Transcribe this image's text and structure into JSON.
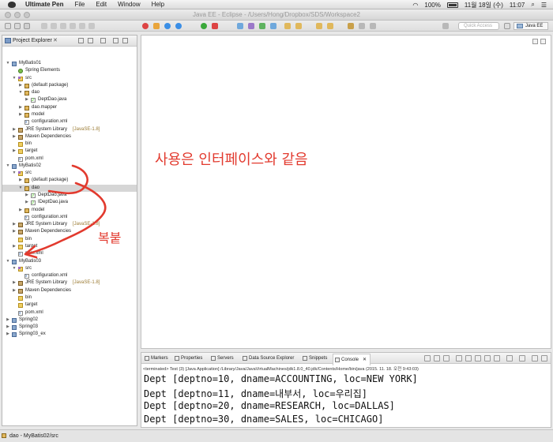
{
  "menubar": {
    "app_name": "Ultimate Pen",
    "items": [
      "File",
      "Edit",
      "Window",
      "Help"
    ],
    "battery": "100%",
    "date": "11월 18일 (수)",
    "time": "11:07"
  },
  "window": {
    "title": "Java EE - Eclipse - /Users/Hong/Dropbox/SDS/Workspace2"
  },
  "toolbar": {
    "quick_access_placeholder": "Quick Access",
    "perspective": "Java EE"
  },
  "explorer": {
    "title": "Project Explorer",
    "tree": [
      {
        "label": "MyBatis01",
        "type": "proj",
        "depth": 0,
        "tw": "▼"
      },
      {
        "label": "Spring Elements",
        "type": "spring",
        "depth": 1,
        "tw": ""
      },
      {
        "label": "src",
        "type": "srcf",
        "depth": 1,
        "tw": "▼"
      },
      {
        "label": "(default package)",
        "type": "pkg",
        "depth": 2,
        "tw": "▶"
      },
      {
        "label": "dao",
        "type": "pkg",
        "depth": 2,
        "tw": "▼"
      },
      {
        "label": "DeptDao.java",
        "type": "java",
        "depth": 3,
        "tw": "▶"
      },
      {
        "label": "dao.mapper",
        "type": "pkg",
        "depth": 2,
        "tw": "▶"
      },
      {
        "label": "model",
        "type": "pkg",
        "depth": 2,
        "tw": "▶"
      },
      {
        "label": "configuration.xml",
        "type": "xml",
        "depth": 2,
        "tw": ""
      },
      {
        "label": "JRE System Library",
        "dec": "[JavaSE-1.8]",
        "type": "lib",
        "depth": 1,
        "tw": "▶"
      },
      {
        "label": "Maven Dependencies",
        "type": "lib",
        "depth": 1,
        "tw": "▶"
      },
      {
        "label": "bin",
        "type": "folder",
        "depth": 1,
        "tw": ""
      },
      {
        "label": "target",
        "type": "folder",
        "depth": 1,
        "tw": "▶"
      },
      {
        "label": "pom.xml",
        "type": "xml",
        "depth": 1,
        "tw": ""
      },
      {
        "label": "MyBatis02",
        "type": "proj",
        "depth": 0,
        "tw": "▼"
      },
      {
        "label": "src",
        "type": "srcf",
        "depth": 1,
        "tw": "▼"
      },
      {
        "label": "(default package)",
        "type": "pkg",
        "depth": 2,
        "tw": "▶"
      },
      {
        "label": "dao",
        "type": "pkg",
        "depth": 2,
        "tw": "▼",
        "selected": true
      },
      {
        "label": "DeptDao.java",
        "type": "java",
        "depth": 3,
        "tw": "▶"
      },
      {
        "label": "IDeptDao.java",
        "type": "java",
        "depth": 3,
        "tw": "▶"
      },
      {
        "label": "model",
        "type": "pkg",
        "depth": 2,
        "tw": "▶"
      },
      {
        "label": "configuration.xml",
        "type": "xml",
        "depth": 2,
        "tw": ""
      },
      {
        "label": "JRE System Library",
        "dec": "[JavaSE-1.8]",
        "type": "lib",
        "depth": 1,
        "tw": "▶"
      },
      {
        "label": "Maven Dependencies",
        "type": "lib",
        "depth": 1,
        "tw": "▶"
      },
      {
        "label": "bin",
        "type": "folder",
        "depth": 1,
        "tw": ""
      },
      {
        "label": "target",
        "type": "folder",
        "depth": 1,
        "tw": "▶"
      },
      {
        "label": "pom.xml",
        "type": "xml",
        "depth": 1,
        "tw": ""
      },
      {
        "label": "MyBatis03",
        "type": "proj",
        "depth": 0,
        "tw": "▼"
      },
      {
        "label": "src",
        "type": "srcf",
        "depth": 1,
        "tw": "▼"
      },
      {
        "label": "configuration.xml",
        "type": "xml",
        "depth": 2,
        "tw": ""
      },
      {
        "label": "JRE System Library",
        "dec": "[JavaSE-1.8]",
        "type": "lib",
        "depth": 1,
        "tw": "▶"
      },
      {
        "label": "Maven Dependencies",
        "type": "lib",
        "depth": 1,
        "tw": "▶"
      },
      {
        "label": "bin",
        "type": "folder",
        "depth": 1,
        "tw": ""
      },
      {
        "label": "target",
        "type": "folder",
        "depth": 1,
        "tw": ""
      },
      {
        "label": "pom.xml",
        "type": "xml",
        "depth": 1,
        "tw": ""
      },
      {
        "label": "Spring02",
        "type": "proj",
        "depth": 0,
        "tw": "▶"
      },
      {
        "label": "Spring03",
        "type": "proj",
        "depth": 0,
        "tw": "▶"
      },
      {
        "label": "Spring03_ex",
        "type": "proj",
        "depth": 0,
        "tw": "▶"
      }
    ]
  },
  "annotations": {
    "note": "사용은 인터페이스와 같음",
    "copy": "복붙"
  },
  "console": {
    "tabs": [
      "Markers",
      "Properties",
      "Servers",
      "Data Source Explorer",
      "Snippets",
      "Console"
    ],
    "active_tab": "Console",
    "terminated": "<terminated> Test (3) [Java Application] /Library/Java/JavaVirtualMachines/jdk1.8.0_40.jdk/Contents/Home/bin/java (2015. 11. 18. 오전 9:43:03)",
    "lines": [
      "Dept [deptno=10, dname=ACCOUNTING, loc=NEW YORK]",
      "Dept [deptno=11, dname=내부서, loc=우리집]",
      "Dept [deptno=20, dname=RESEARCH, loc=DALLAS]",
      "Dept [deptno=30, dname=SALES, loc=CHICAGO]"
    ]
  },
  "status": {
    "text": "dao - MyBatis02/src"
  }
}
